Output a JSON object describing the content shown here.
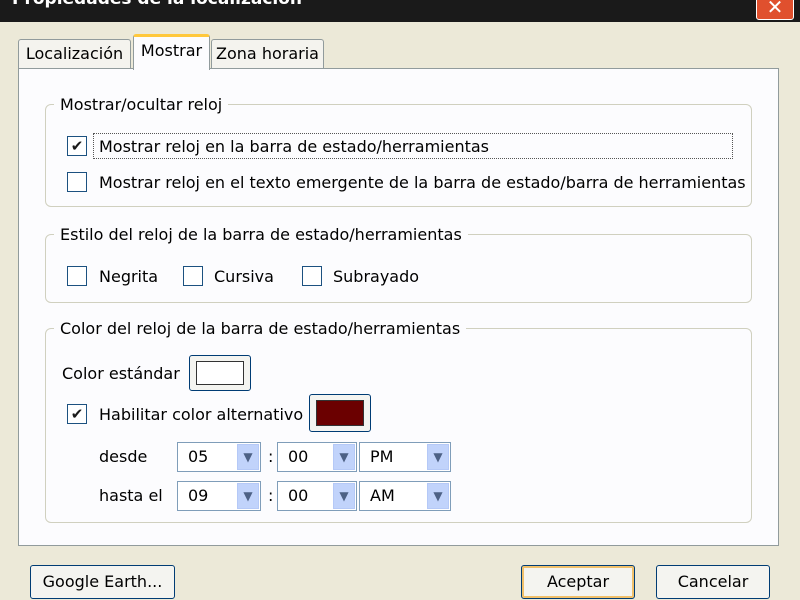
{
  "window": {
    "title": "Propiedades de la localización",
    "close_glyph": "✕"
  },
  "tabs": [
    {
      "label": "Localización",
      "active": false
    },
    {
      "label": "Mostrar",
      "active": true
    },
    {
      "label": "Zona horaria",
      "active": false
    }
  ],
  "show_clock": {
    "legend": "Mostrar/ocultar reloj",
    "options": [
      {
        "label": "Mostrar reloj en la barra de estado/herramientas",
        "checked": true
      },
      {
        "label": "Mostrar reloj en el texto emergente de la barra de estado/barra de herramientas",
        "checked": false
      }
    ]
  },
  "clock_style": {
    "legend": "Estilo del reloj de la barra de estado/herramientas",
    "options": [
      {
        "label": "Negrita",
        "checked": false
      },
      {
        "label": "Cursiva",
        "checked": false
      },
      {
        "label": "Subrayado",
        "checked": false
      }
    ]
  },
  "clock_color": {
    "legend": "Color del reloj de la barra de estado/herramientas",
    "standard_label": "Color estándar",
    "standard_color": "#ffffff",
    "alternate_label": "Habilitar color alternativo",
    "alternate_checked": true,
    "alternate_color": "#6b0000",
    "from_label": "desde",
    "to_label": "hasta el",
    "from": {
      "hour": "05",
      "minute": "00",
      "ampm": "PM"
    },
    "to": {
      "hour": "09",
      "minute": "00",
      "ampm": "AM"
    },
    "separator": ":"
  },
  "footer": {
    "google_earth_label": "Google Earth...",
    "ok_label": "Aceptar",
    "cancel_label": "Cancelar"
  },
  "icons": {
    "dropdown": "▼",
    "check": "✔"
  }
}
